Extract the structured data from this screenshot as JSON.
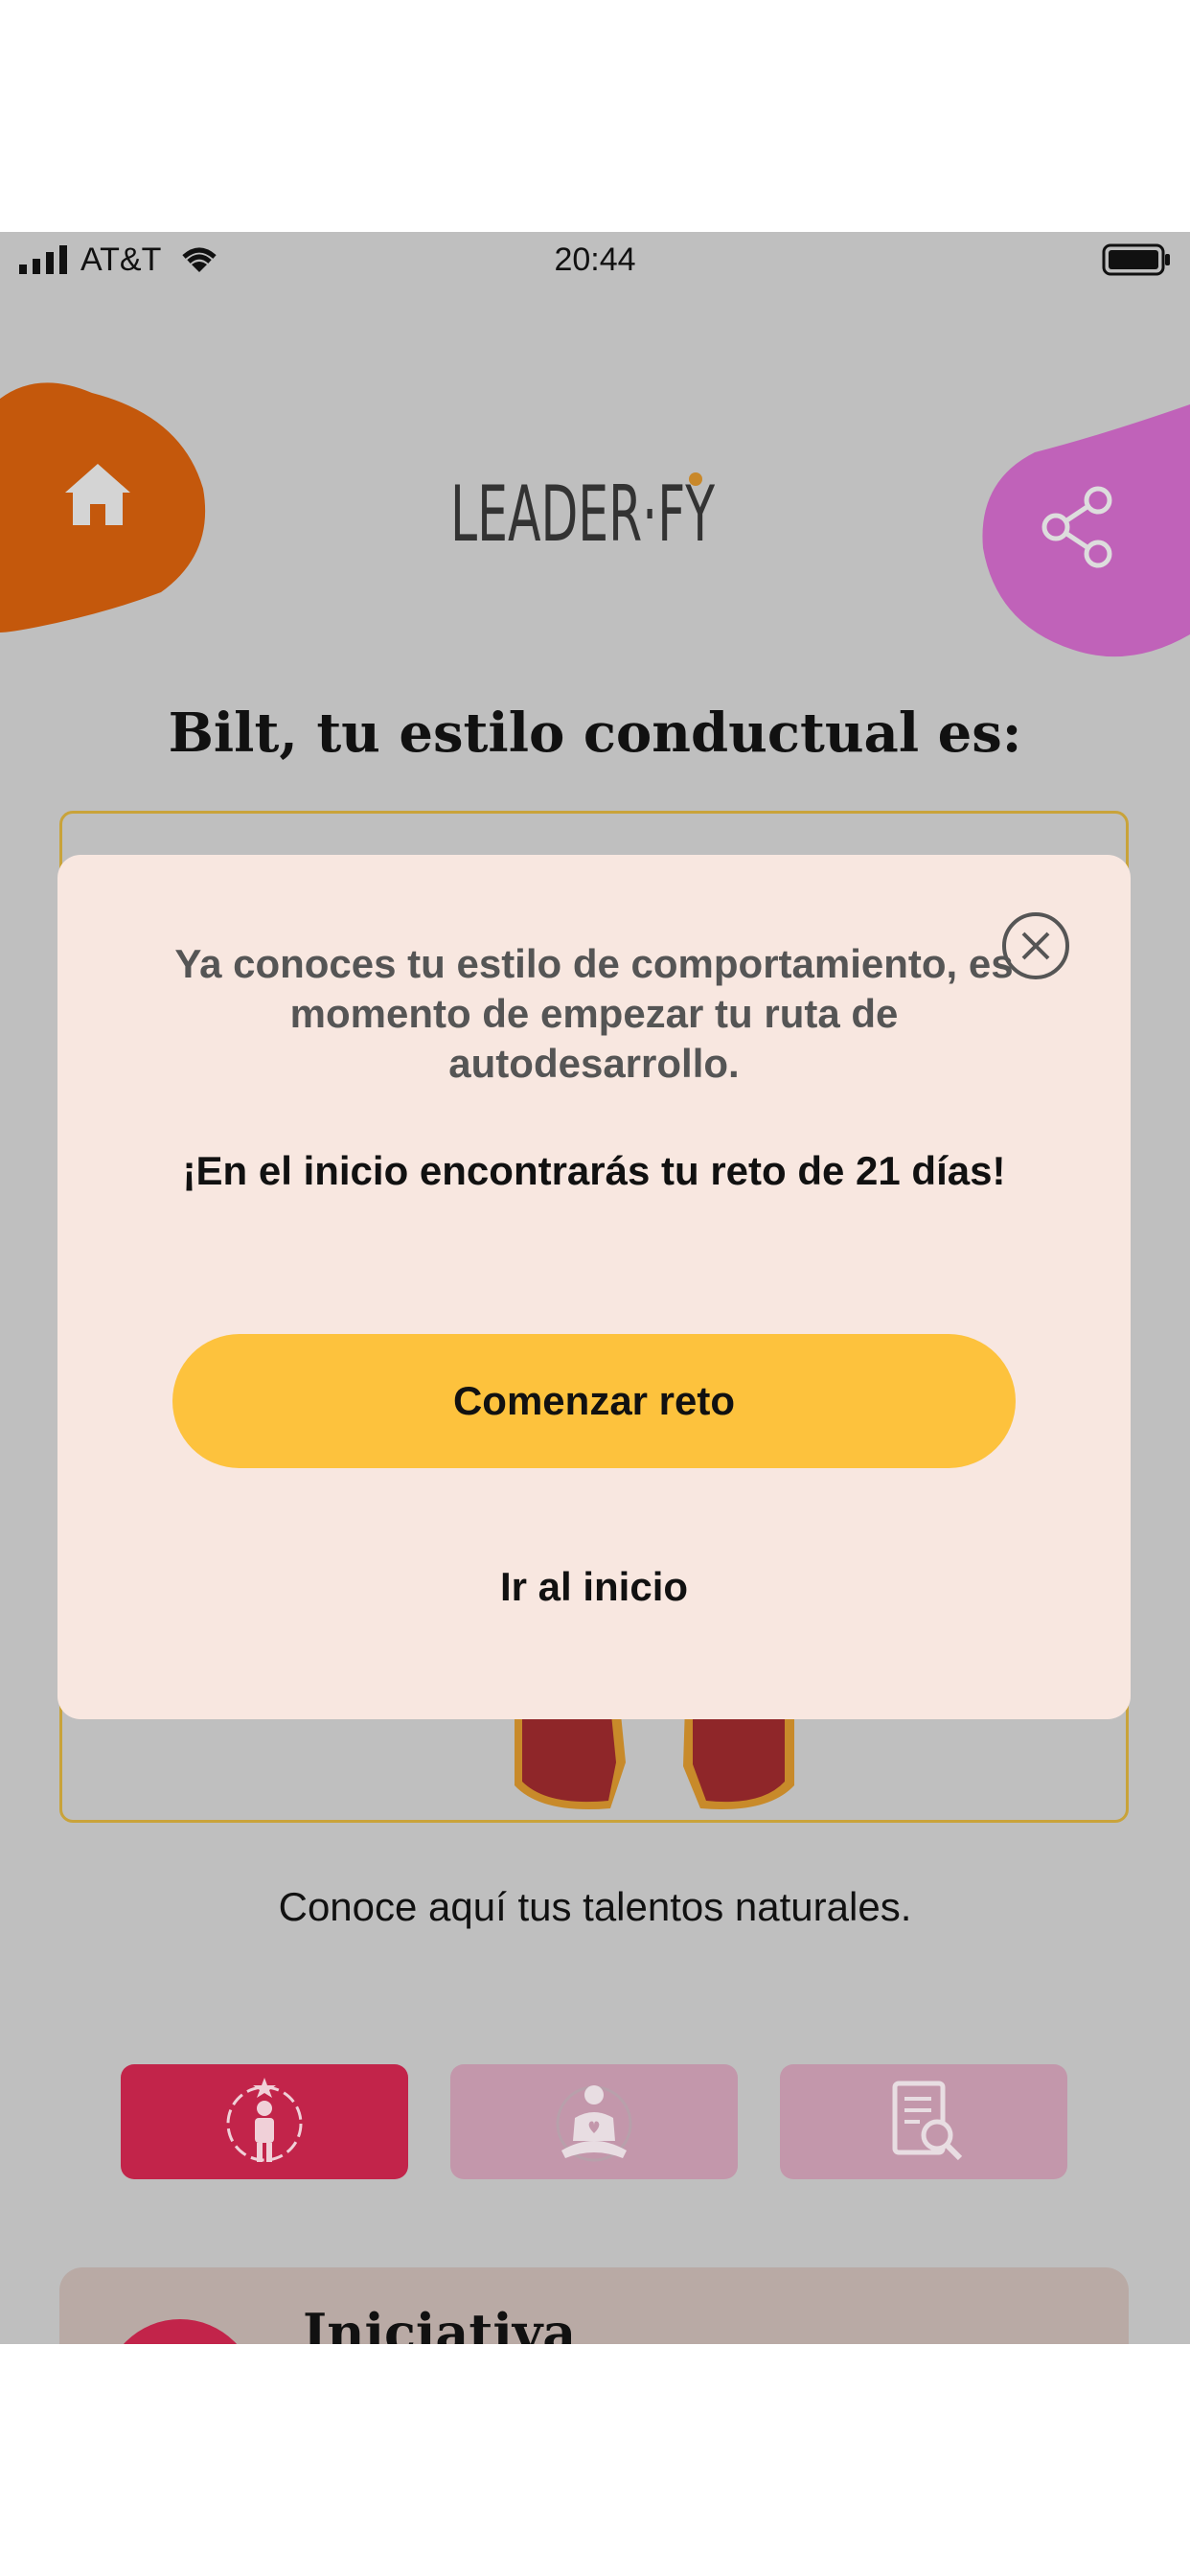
{
  "status_bar": {
    "carrier": "AT&T",
    "time": "20:44"
  },
  "header": {
    "logo_text": "LEADER·FY"
  },
  "result": {
    "title": "Bilt, tu estilo conductual es:"
  },
  "modal": {
    "message": "Ya conoces tu estilo de comportamiento, es momento de empezar tu ruta de autodesarrollo.",
    "highlight": "¡En el inicio encontrarás tu reto de 21 días!",
    "primary_button": "Comenzar reto",
    "secondary_link": "Ir al inicio"
  },
  "talents": {
    "caption": "Conoce aquí tus talentos naturales."
  },
  "bottom_card": {
    "heading": "Iniciativa"
  },
  "colors": {
    "home_blob": "#c4580c",
    "share_blob": "#c062b9",
    "accent_yellow": "#fdc23d",
    "tab_active": "#c2244a",
    "tab_inactive": "#c397ab",
    "overlay_bg": "#bfbfbf",
    "modal_bg": "#f8e7e0"
  },
  "icons": {
    "home": "home-icon",
    "share": "share-icon",
    "close": "close-icon",
    "tab1": "leader-icon",
    "tab2": "meditation-icon",
    "tab3": "document-search-icon"
  }
}
